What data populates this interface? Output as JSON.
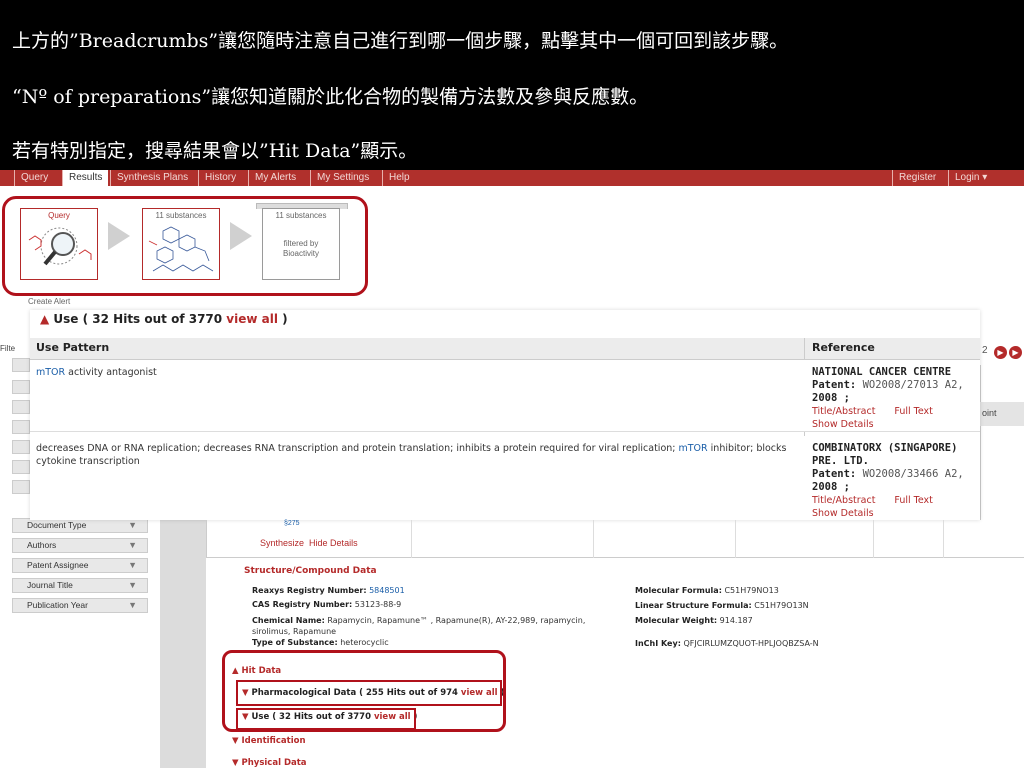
{
  "annotations": {
    "line1": "上方的”Breadcrumbs”讓您隨時注意自己進行到哪一個步驟，點擊其中一個可回到該步驟。",
    "line2": "“Nº of preparations”讓您知道關於此化合物的製備方法數及參與反應數。",
    "line3": "若有特別指定，搜尋結果會以”Hit Data”顯示。"
  },
  "nav": {
    "items": [
      "Query",
      "Results",
      "Synthesis Plans",
      "History",
      "My Alerts",
      "My Settings",
      "Help"
    ],
    "register": "Register",
    "login": "Login ▾"
  },
  "breadcrumbs": {
    "query_label": "Query",
    "substances_label": "11 substances",
    "filtered_label": "11 substances",
    "filtered_sub1": "filtered by",
    "filtered_sub2": "Bioactivity"
  },
  "create_alert": "Create Alert",
  "use_panel": {
    "title_prefix": "Use ( 32 Hits out of 3770 ",
    "title_link": "view all",
    "title_suffix": " )",
    "col_pattern": "Use Pattern",
    "col_reference": "Reference",
    "rows": [
      {
        "pattern_link": "mTOR",
        "pattern_text": " activity antagonist",
        "org": "NATIONAL CANCER CENTRE",
        "patent_label": "Patent:",
        "patent_value": "WO2008/27013 A2,",
        "year": "2008 ;",
        "link1": "Title/Abstract",
        "link2": "Full Text",
        "details": "Show Details"
      },
      {
        "pattern_pre": "decreases DNA or RNA replication; decreases RNA transcription and protein translation; inhibits a protein required for viral replication; ",
        "pattern_link": "mTOR",
        "pattern_post": " inhibitor; blocks cytokine transcription",
        "org": "COMBINATORX (SINGAPORE) PRE. LTD.",
        "patent_label": "Patent:",
        "patent_value": "WO2008/33466 A2,",
        "year": "2008 ;",
        "link1": "Title/Abstract",
        "link2": "Full Text",
        "details": "Show Details"
      }
    ]
  },
  "sidebar": {
    "filter_label": "Filte",
    "facets": [
      "Document Type",
      "Authors",
      "Patent Assignee",
      "Journal Title",
      "Publication Year"
    ]
  },
  "pager": {
    "page_text": "2"
  },
  "right_fragment": "oint",
  "results": {
    "tiny": "§275",
    "synthesize": "Synthesize",
    "hide_details": "Hide Details"
  },
  "compound": {
    "section_title": "Structure/Compound Data",
    "reaxys_label": "Reaxys Registry Number:",
    "reaxys_value": "5848501",
    "cas_label": "CAS Registry Number:",
    "cas_value": "53123-88-9",
    "chem_label": "Chemical Name:",
    "chem_value1": "Rapamycin, Rapamune™ , Rapamune(R), AY-22,989, rapamycin,",
    "chem_value2": "sirolimus, Rapamune",
    "type_label": "Type of Substance:",
    "type_value": "heterocyclic",
    "mf_label": "Molecular Formula:",
    "mf_value": "C51H79NO13",
    "lsf_label": "Linear Structure Formula:",
    "lsf_value": "C51H79O13N",
    "mw_label": "Molecular Weight:",
    "mw_value": "914.187",
    "inchi_label": "InChI Key:",
    "inchi_value": "QFJCIRLUMZQUOT-HPLJOQBZSA-N"
  },
  "hit_data": {
    "title": "Hit Data",
    "pharma_prefix": "Pharmacological Data ( 255 Hits out of 974 ",
    "pharma_link": "view all",
    "pharma_suffix": " )",
    "use_prefix": "Use ( 32 Hits out of 3770 ",
    "use_link": "view all",
    "use_suffix": " )",
    "identification": "Identification",
    "physical": "Physical Data"
  },
  "colors": {
    "brand_red": "#b0302c",
    "highlight": "#b0111b",
    "link_blue": "#1a5ea8"
  }
}
